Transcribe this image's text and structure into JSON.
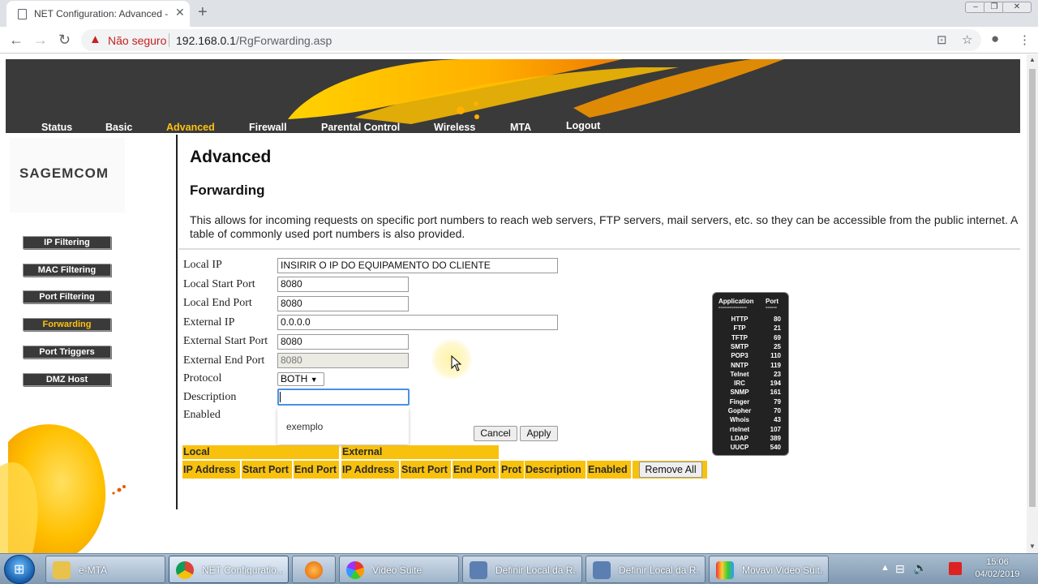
{
  "browser": {
    "tab_title": "NET Configuration: Advanced - F",
    "security_label": "Não seguro",
    "url_host": "192.168.0.1",
    "url_path": "/RgForwarding.asp"
  },
  "nav": [
    "Status",
    "Basic",
    "Advanced",
    "Firewall",
    "Parental Control",
    "Wireless",
    "MTA",
    "Logout"
  ],
  "brand": "SAGEMCOM",
  "sidebar": [
    "IP Filtering",
    "MAC Filtering",
    "Port Filtering",
    "Forwarding",
    "Port Triggers",
    "DMZ Host"
  ],
  "page": {
    "title": "Advanced",
    "subtitle": "Forwarding",
    "description": "This allows for incoming requests on specific port numbers to reach web servers, FTP servers, mail servers, etc. so they can be accessible from the public internet. A table of commonly used port numbers is also provided."
  },
  "form": {
    "labels": [
      "Local IP",
      "Local Start Port",
      "Local End Port",
      "External IP",
      "External Start Port",
      "External End Port",
      "Protocol",
      "Description",
      "Enabled"
    ],
    "local_ip": "INSIRIR O IP DO EQUIPAMENTO DO CLIENTE",
    "local_start_port": "8080",
    "local_end_port": "8080",
    "external_ip": "0.0.0.0",
    "external_start_port": "8080",
    "external_end_port": "8080",
    "protocol": "BOTH",
    "description": "",
    "autocomplete_option": "exemplo",
    "cancel": "Cancel",
    "apply": "Apply"
  },
  "table": {
    "group_local": "Local",
    "group_external": "External",
    "columns": [
      "IP Address",
      "Start Port",
      "End Port",
      "IP Address",
      "Start Port",
      "End Port",
      "Prot",
      "Description",
      "Enabled"
    ],
    "remove_all": "Remove All"
  },
  "port_table": {
    "header_app": "Application",
    "header_port": "Port",
    "rows": [
      [
        "HTTP",
        "80"
      ],
      [
        "FTP",
        "21"
      ],
      [
        "TFTP",
        "69"
      ],
      [
        "SMTP",
        "25"
      ],
      [
        "POP3",
        "110"
      ],
      [
        "NNTP",
        "119"
      ],
      [
        "Telnet",
        "23"
      ],
      [
        "IRC",
        "194"
      ],
      [
        "SNMP",
        "161"
      ],
      [
        "Finger",
        "79"
      ],
      [
        "Gopher",
        "70"
      ],
      [
        "Whois",
        "43"
      ],
      [
        "rtelnet",
        "107"
      ],
      [
        "LDAP",
        "389"
      ],
      [
        "UUCP",
        "540"
      ]
    ]
  },
  "taskbar": {
    "items": [
      "e-MTA",
      "NET Configuratio...",
      "",
      "Video Suite",
      "Definir Local da R...",
      "Definir Local da R...",
      "Movavi Video Suit..."
    ],
    "time": "15:06",
    "date": "04/02/2019"
  },
  "colors": {
    "accent": "#f8c10d",
    "header_bg": "#3a3a3a"
  }
}
